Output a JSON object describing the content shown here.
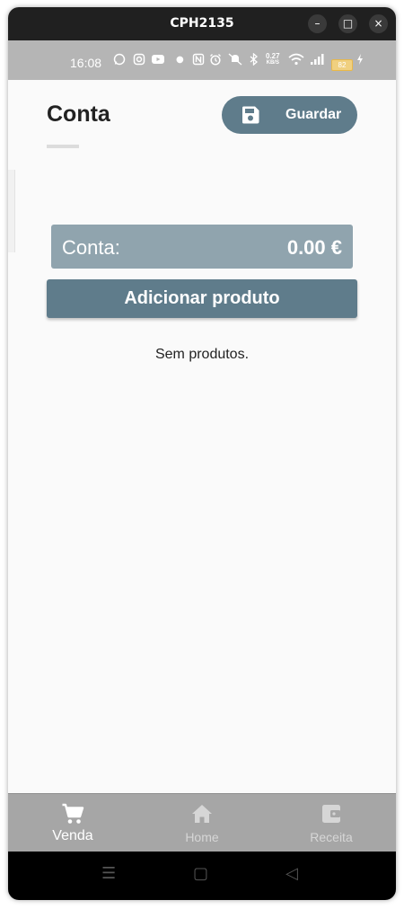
{
  "window": {
    "title": "CPH2135",
    "controls": {
      "minimize": "–",
      "maximize": "□",
      "close": "×"
    }
  },
  "status_bar": {
    "time": "16:08",
    "icons": [
      "whatsapp-icon",
      "instagram-icon",
      "youtube-icon",
      "dot-icon",
      "nfc-icon",
      "alarm-icon",
      "mute-icon",
      "bluetooth-icon",
      "wifi-icon",
      "signal-icon",
      "charging-icon"
    ],
    "network_speed_value": "0.27",
    "network_speed_unit": "KB/S",
    "battery": "82"
  },
  "header": {
    "title": "Conta",
    "save_label": "Guardar",
    "save_icon": "floppy-disk-icon"
  },
  "total": {
    "label": "Conta:",
    "value": "0.00 €"
  },
  "add_product_label": "Adicionar produto",
  "empty_message": "Sem produtos.",
  "bottom_nav": [
    {
      "label": "Venda",
      "icon": "cart-icon",
      "active": true
    },
    {
      "label": "Home",
      "icon": "home-icon",
      "active": false
    },
    {
      "label": "Receita",
      "icon": "wallet-icon",
      "active": false
    }
  ],
  "system_nav": {
    "menu": "☰",
    "home": "▢",
    "back": "◁"
  },
  "colors": {
    "accent": "#5f7c8b",
    "card": "#90a4ae",
    "nav_bg": "#a6a6a6",
    "nav_active": "#ffffff",
    "nav_inactive": "#d6d6d6",
    "title_bar": "#202020",
    "status_bar": "#b5b5b5"
  }
}
